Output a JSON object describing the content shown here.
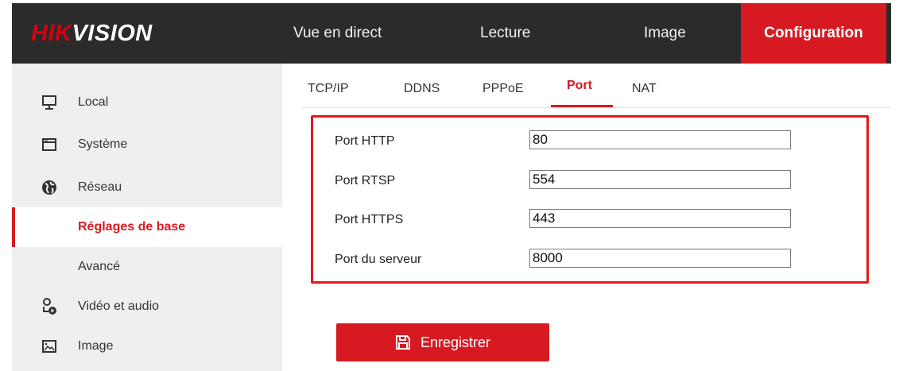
{
  "brand": {
    "part1": "HIK",
    "part2": "VISION"
  },
  "nav": {
    "live": "Vue en direct",
    "playback": "Lecture",
    "image": "Image",
    "config": "Configuration"
  },
  "sidebar": {
    "items": [
      {
        "label": "Local",
        "icon": "monitor-icon"
      },
      {
        "label": "Système",
        "icon": "window-icon"
      },
      {
        "label": "Réseau",
        "icon": "globe-icon"
      },
      {
        "label": "Réglages de base",
        "selected": true
      },
      {
        "label": "Avancé"
      },
      {
        "label": "Vidéo et audio",
        "icon": "camera-person-icon"
      },
      {
        "label": "Image",
        "icon": "picture-icon"
      }
    ]
  },
  "tabs": {
    "tcpip": "TCP/IP",
    "ddns": "DDNS",
    "pppoe": "PPPoE",
    "port": "Port",
    "nat": "NAT"
  },
  "form": {
    "http": {
      "label": "Port HTTP",
      "value": "80"
    },
    "rtsp": {
      "label": "Port RTSP",
      "value": "554"
    },
    "https": {
      "label": "Port HTTPS",
      "value": "443"
    },
    "server": {
      "label": "Port du serveur",
      "value": "8000"
    }
  },
  "save_label": "Enregistrer",
  "colors": {
    "accent": "#d71a22",
    "topbar": "#2b2b2b",
    "sidebar": "#efefef"
  }
}
